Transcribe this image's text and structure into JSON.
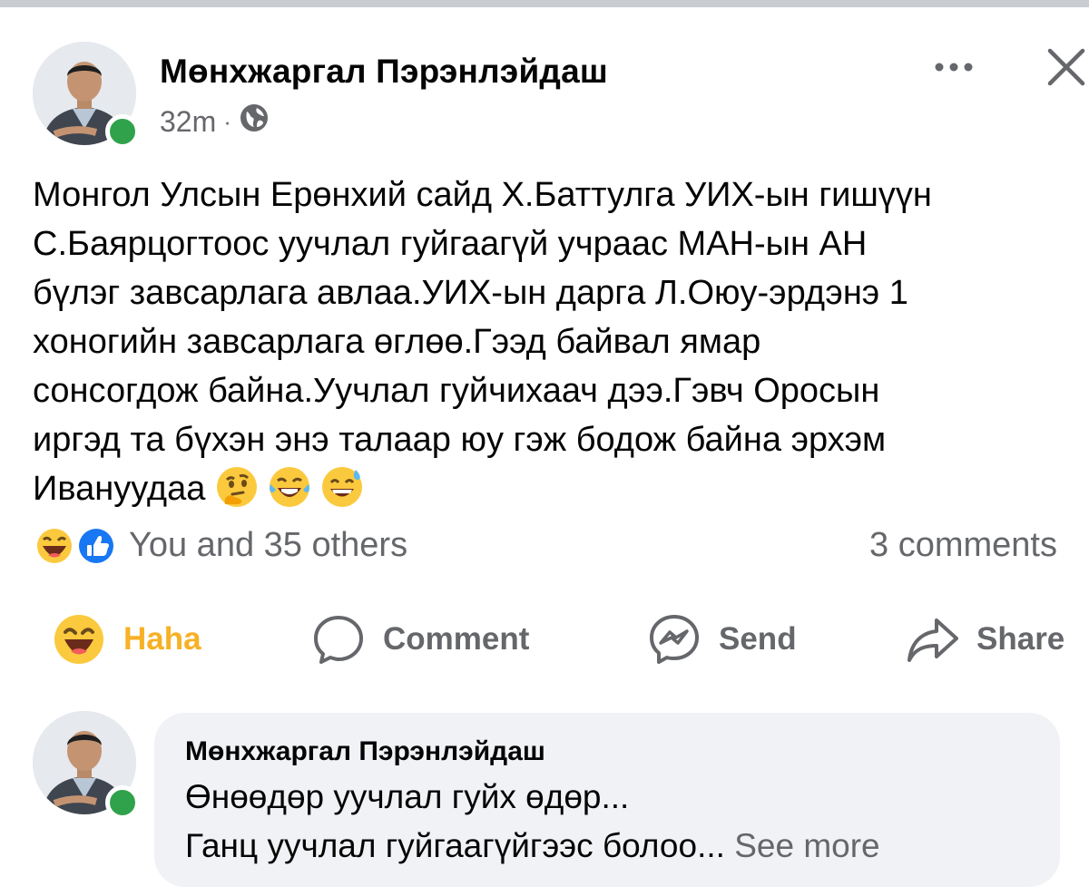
{
  "post": {
    "author": "Мөнхжаргал Пэрэнлэйдаш",
    "time": "32m",
    "separator": "·",
    "text": "Монгол Улсын Ерөнхий сайд Х.Баттулга УИХ-ын гишүүн\nС.Баярцогтоос уучлал гуйгаагүй учраас МАН-ын АН\nбүлэг завсарлага авлаа.УИХ-ын дарга Л.Оюу-эрдэнэ 1\nхоногийн завсарлага өглөө.Гээд байвал ямар\nсонсогдож байна.Уучлал гуйчихаач дээ.Гэвч Оросын\nиргэд та бүхэн энэ талаар юу гэж бодож байна эрхэм\nИвануудаа",
    "text_emojis": [
      "thinking-face",
      "laughing-crying-face",
      "sweat-smile-face"
    ],
    "reactions": {
      "icons": [
        "haha",
        "like"
      ],
      "summary": "You and 35 others"
    },
    "comments_count": "3 comments"
  },
  "actions": [
    {
      "label": "Haha",
      "icon": "haha-reaction-icon",
      "active_color": "#f7b125"
    },
    {
      "label": "Comment",
      "icon": "comment-bubble-icon"
    },
    {
      "label": "Send",
      "icon": "messenger-icon"
    },
    {
      "label": "Share",
      "icon": "share-arrow-icon"
    }
  ],
  "comment": {
    "author": "Мөнхжаргал Пэрэнлэйдаш",
    "line1": "Өнөөдөр уучлал гуйх өдөр...",
    "line2": "Ганц уучлал гуйгаагүйгээс болоо...",
    "see_more": "See more"
  },
  "colors": {
    "online": "#31a24c",
    "secondary_text": "#65676b",
    "like_blue": "#1877f2",
    "bubble_bg": "#f0f2f5"
  }
}
